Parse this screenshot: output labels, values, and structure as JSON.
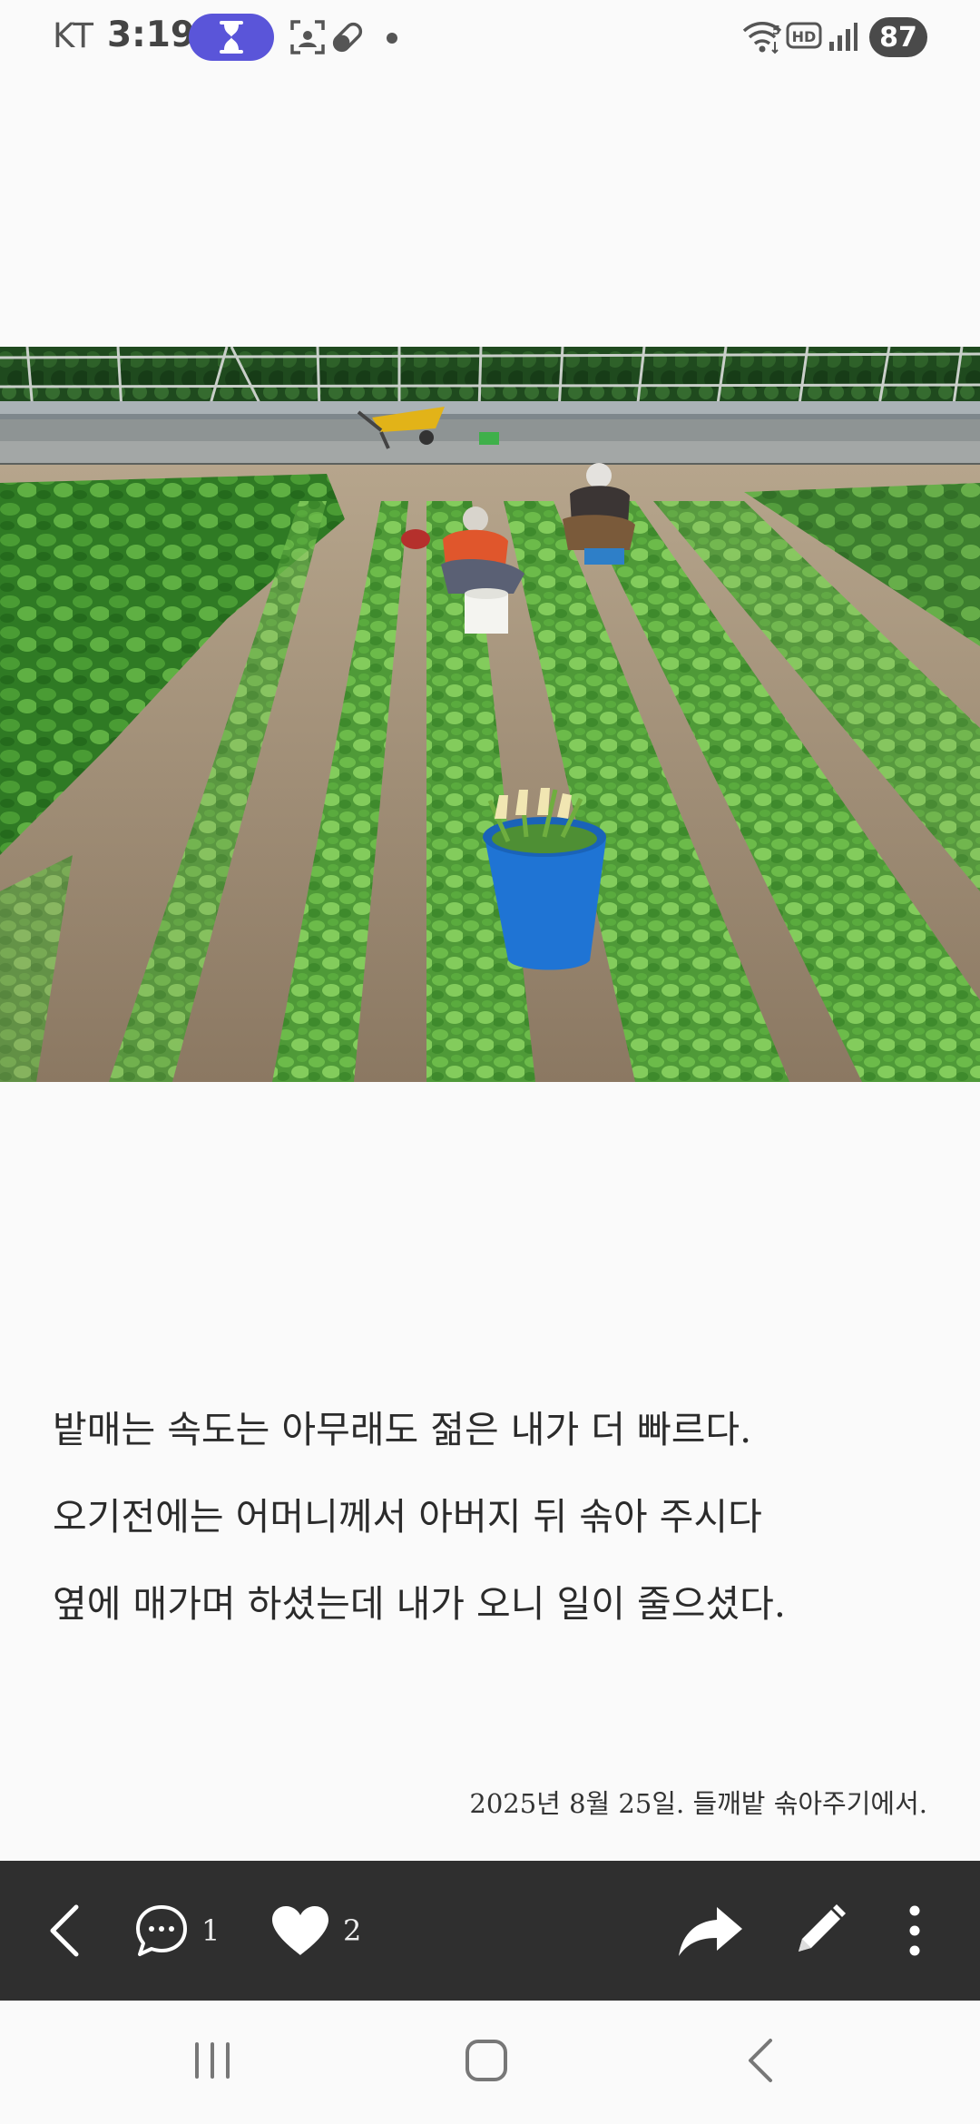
{
  "status_bar": {
    "carrier": "KT",
    "time": "3:19",
    "battery": "87",
    "icons": [
      "hourglass-icon",
      "screenshot-icon",
      "pill-icon",
      "notification-dot-icon",
      "wifi-icon",
      "hd-icon",
      "signal-icon",
      "battery-icon"
    ],
    "accent_color": "#5a55d9"
  },
  "post": {
    "caption_lines": [
      "밭매는 속도는 아무래도 젊은 내가 더 빠르다.",
      "오기전에는 어머니께서 아버지 뒤 솎아 주시다",
      "옆에 매가며 하셨는데 내가 오니 일이 줄으셨다."
    ],
    "signature": "2025년 8월 25일. 들깨밭 솎아주기에서."
  },
  "action_bar": {
    "comment_count": "1",
    "like_count": "2",
    "icons": [
      "back-arrow-icon",
      "comment-icon",
      "heart-icon",
      "share-icon",
      "edit-pencil-icon",
      "more-vert-icon"
    ],
    "background": "#2f2f2f"
  },
  "nav_bar": {
    "icons": [
      "recent-apps-icon",
      "home-icon",
      "back-icon"
    ]
  }
}
